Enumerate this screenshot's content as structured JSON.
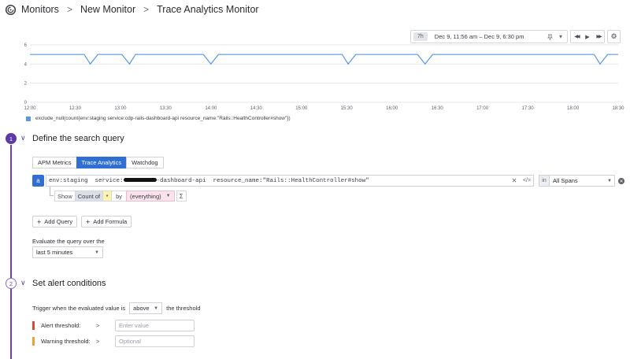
{
  "breadcrumb": {
    "items": [
      "Monitors",
      "New Monitor",
      "Trace Analytics Monitor"
    ],
    "separator": ">"
  },
  "time_controls": {
    "badge": "7h",
    "range": "Dec 9, 11:56 am – Dec 9, 6:30 pm",
    "pin_icon": "pin-icon",
    "caret": "▾",
    "back_icon": "◀◀",
    "play_icon": "▶",
    "forward_icon": "▶▶",
    "settings_icon": "⚙"
  },
  "chart_data": {
    "type": "line",
    "title": "",
    "xlabel": "",
    "ylabel": "",
    "y_ticks": [
      "6",
      "4",
      "2",
      "0"
    ],
    "ylim": [
      0,
      6
    ],
    "x_ticks": [
      "12:00",
      "12:30",
      "13:00",
      "13:30",
      "14:00",
      "14:30",
      "15:00",
      "15:30",
      "16:00",
      "16:30",
      "17:00",
      "17:30",
      "18:00",
      "18:30"
    ],
    "grid": true,
    "series": [
      {
        "name": "exclude_null(count{env:staging service:cdp-rails-dashboard-api resource_name:\"Rails::HealthController#show\"})",
        "color": "#5b97e5",
        "x": [
          "12:00",
          "12:36",
          "12:40",
          "12:45",
          "13:01",
          "13:06",
          "13:10",
          "13:55",
          "14:00",
          "14:05",
          "15:27",
          "15:31",
          "15:36",
          "16:17",
          "16:22",
          "16:27",
          "18:14",
          "18:18",
          "18:23",
          "18:30"
        ],
        "values": [
          5,
          5,
          4,
          5,
          5,
          4,
          5,
          5,
          4,
          5,
          5,
          4,
          5,
          5,
          4,
          5,
          5,
          4,
          5,
          5
        ]
      }
    ]
  },
  "define_section": {
    "step": "1",
    "chev": "∨",
    "title": "Define the search query",
    "tabs": [
      "APM Metrics",
      "Trace Analytics",
      "Watchdog"
    ],
    "active_tab": "Trace Analytics",
    "query": {
      "letter": "a",
      "tokens": {
        "env": "env:staging",
        "service_prefix": "service:",
        "service_suffix": "-dashboard-api",
        "resource": "resource_name:\"Rails::HealthController#show\""
      },
      "clear_icon": "✕",
      "code_icon": "</>",
      "in_label": "in",
      "scope": "All Spans",
      "remove_icon": "✕"
    },
    "show": {
      "show_label": "Show",
      "count_label": "Count of",
      "star": "*",
      "by_label": "by",
      "group": "(everything)",
      "sigma": "Σ"
    },
    "add_query": "Add Query",
    "add_formula": "Add Formula",
    "eval_label": "Evaluate the query over the",
    "eval_value": "last 5 minutes"
  },
  "alert_section": {
    "step": "2",
    "chev": "∨",
    "title": "Set alert conditions",
    "trigger_prefix": "Trigger when the evaluated value is",
    "trigger_op": "above",
    "trigger_suffix": "the threshold",
    "alert_label": "Alert threshold:",
    "alert_op": ">",
    "alert_placeholder": "Enter value",
    "alert_color": "#d64a3a",
    "warning_label": "Warning threshold:",
    "warning_op": ">",
    "warning_placeholder": "Optional",
    "warning_color": "#e9a23b"
  }
}
